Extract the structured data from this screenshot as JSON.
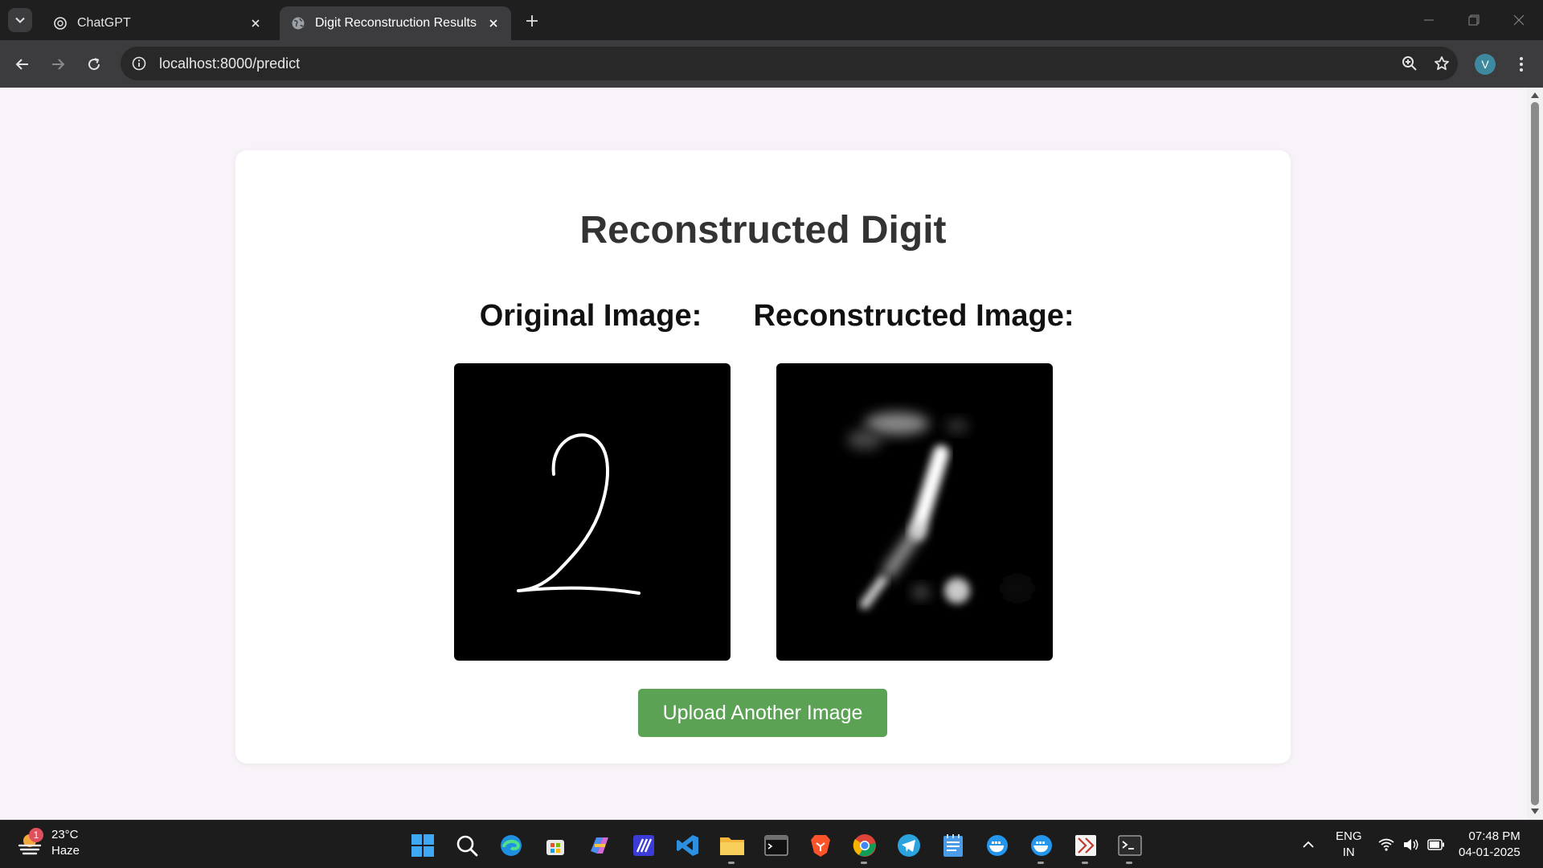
{
  "browser": {
    "tabs": [
      {
        "label": "ChatGPT",
        "favicon": "chatgpt-icon",
        "active": false
      },
      {
        "label": "Digit Reconstruction Results",
        "favicon": "globe-icon",
        "active": true
      }
    ],
    "address": "localhost:8000/predict",
    "profile_initial": "V"
  },
  "page": {
    "heading": "Reconstructed Digit",
    "original_label": "Original Image:",
    "reconstructed_label": "Reconstructed Image:",
    "upload_button": "Upload Another Image",
    "accent_color": "#5ba255"
  },
  "taskbar": {
    "weather": {
      "temperature": "23°C",
      "condition": "Haze",
      "badge": "1"
    },
    "apps": [
      "windows-start-icon",
      "search-icon",
      "edge-icon",
      "store-icon",
      "copilot-icon",
      "app-icon",
      "vscode-icon",
      "file-explorer-icon",
      "terminal-icon",
      "brave-icon",
      "chrome-icon",
      "telegram-icon",
      "notepad-icon",
      "docker-icon",
      "docker-icon",
      "app-icon",
      "terminal-icon"
    ],
    "language": {
      "line1": "ENG",
      "line2": "IN"
    },
    "clock": {
      "time": "07:48 PM",
      "date": "04-01-2025"
    }
  }
}
